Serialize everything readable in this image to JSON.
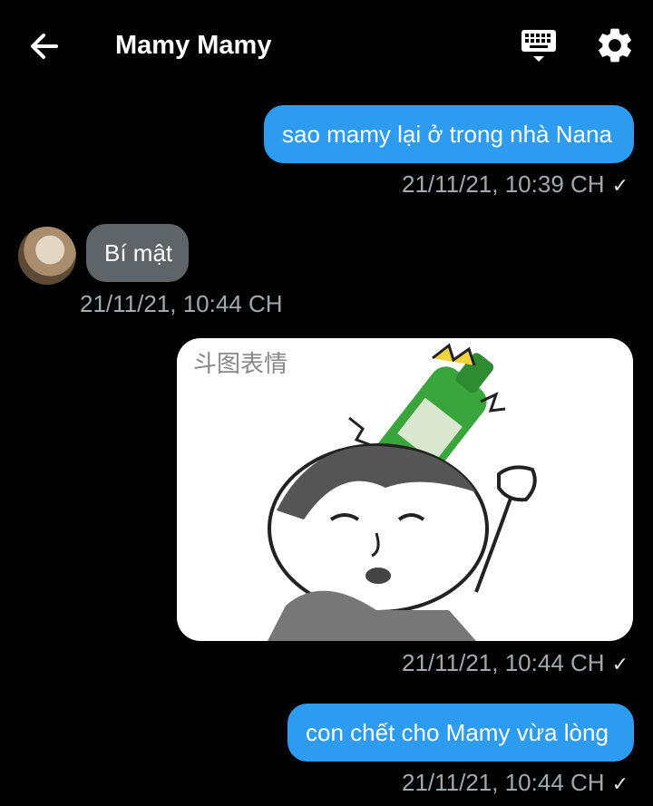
{
  "header": {
    "title": "Mamy Mamy",
    "back_icon": "arrow-left-icon",
    "keyboard_icon": "keyboard-icon",
    "settings_icon": "gear-icon"
  },
  "colors": {
    "background": "#000000",
    "outgoing_bubble": "#2d9cf0",
    "incoming_bubble": "#5f6468",
    "timestamp": "#a3a9af"
  },
  "messages": [
    {
      "direction": "outgoing",
      "text": "sao mamy lại ở trong nhà Nana",
      "time": "21/11/21, 10:39 CH",
      "read_mark": "✓"
    },
    {
      "direction": "incoming",
      "text": "Bí mật",
      "time": "21/11/21, 10:44 CH"
    },
    {
      "direction": "outgoing",
      "type": "image",
      "image_watermark": "斗图表情",
      "time": "21/11/21, 10:44 CH",
      "read_mark": "✓"
    },
    {
      "direction": "outgoing",
      "text": "con chết cho Mamy vừa lòng",
      "time": "21/11/21, 10:44 CH",
      "read_mark": "✓"
    }
  ]
}
